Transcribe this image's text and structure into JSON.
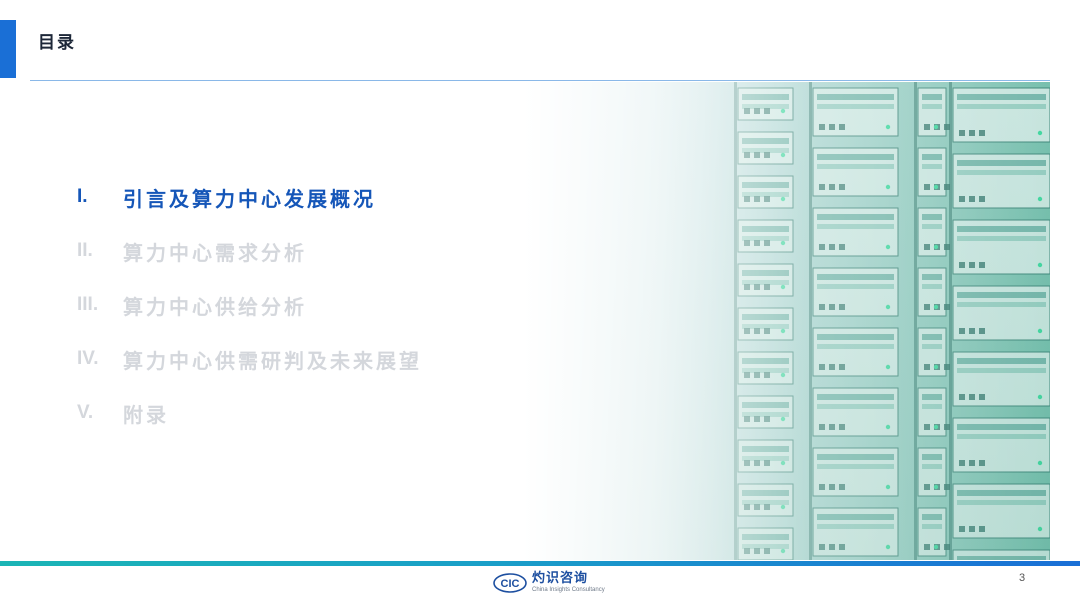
{
  "header": {
    "title": "目录"
  },
  "toc": {
    "items": [
      {
        "num": "I.",
        "label": "引言及算力中心发展概况",
        "active": true
      },
      {
        "num": "II.",
        "label": "算力中心需求分析",
        "active": false
      },
      {
        "num": "III.",
        "label": "算力中心供给分析",
        "active": false
      },
      {
        "num": "IV.",
        "label": "算力中心供需研判及未来展望",
        "active": false
      },
      {
        "num": "V.",
        "label": "附录",
        "active": false
      }
    ]
  },
  "footer": {
    "logo_mark": "CIC",
    "logo_cn": "灼识咨询",
    "logo_en": "China Insights Consultancy",
    "page_number": "3"
  },
  "colors": {
    "accent": "#1a6fd6",
    "active_text": "#1556b8",
    "inactive_text": "#d4d7dc",
    "footer_gradient_start": "#1bb5b5",
    "footer_gradient_end": "#1a6fd6"
  },
  "image": {
    "subject": "server-rack-photo"
  }
}
